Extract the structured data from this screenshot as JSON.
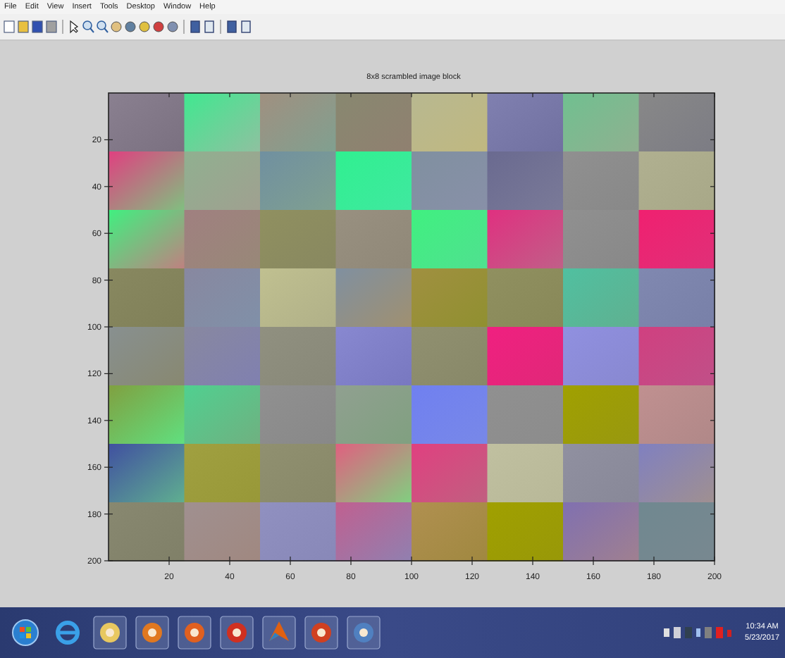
{
  "menu_bar": [
    "File",
    "Edit",
    "View",
    "Insert",
    "Tools",
    "Desktop",
    "Window",
    "Help"
  ],
  "figure": {
    "title": "8x8 scrambled image block",
    "axes": {
      "xticks": [
        "20",
        "40",
        "60",
        "80",
        "100",
        "120",
        "140",
        "160",
        "180",
        "200"
      ],
      "yticks": [
        "20",
        "40",
        "60",
        "80",
        "100",
        "120",
        "140",
        "160",
        "180",
        "200"
      ]
    }
  },
  "taskbar": {
    "time": "10:34 AM",
    "date": "5/23/2017"
  }
}
